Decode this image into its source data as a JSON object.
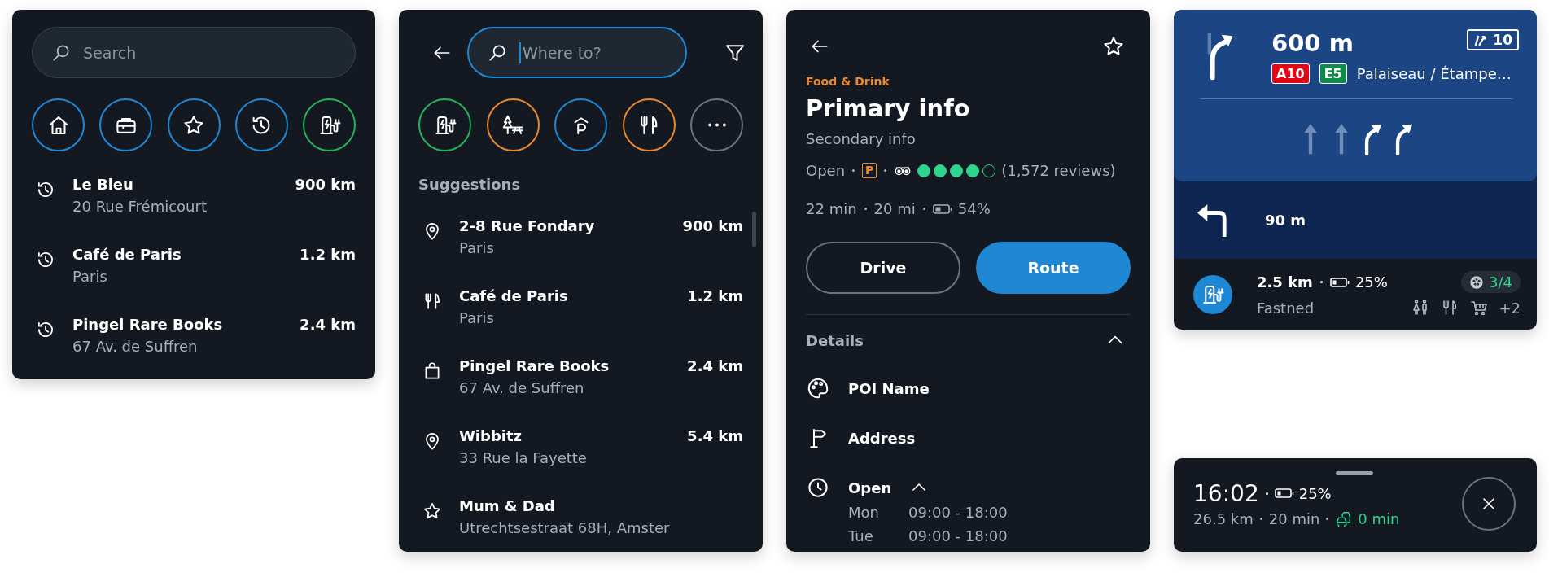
{
  "search_panel": {
    "search": {
      "placeholder": "Search"
    },
    "shortcuts": [
      {
        "kind": "home",
        "color": "#1e88d4"
      },
      {
        "kind": "work",
        "color": "#1e88d4"
      },
      {
        "kind": "favorite",
        "color": "#1e88d4"
      },
      {
        "kind": "recent",
        "color": "#1e88d4"
      },
      {
        "kind": "charging",
        "color": "#27b25a"
      }
    ],
    "recents": [
      {
        "kind": "recent",
        "name": "Le Bleu",
        "address": "20 Rue Frémicourt",
        "distance": "900 km"
      },
      {
        "kind": "recent",
        "name": "Café de Paris",
        "address": "Paris",
        "distance": "1.2 km"
      },
      {
        "kind": "recent",
        "name": "Pingel Rare Books",
        "address": "67 Av. de Suffren",
        "distance": "2.4 km"
      }
    ]
  },
  "suggest_panel": {
    "search": {
      "placeholder": "Where to?",
      "focused": true
    },
    "categories": [
      {
        "kind": "charging",
        "color": "#27b25a"
      },
      {
        "kind": "nature",
        "color": "#e8892f"
      },
      {
        "kind": "parking",
        "color": "#1e88d4"
      },
      {
        "kind": "food",
        "color": "#e8892f"
      },
      {
        "kind": "more",
        "color": "#6e737b"
      }
    ],
    "heading": "Suggestions",
    "items": [
      {
        "kind": "pin",
        "name": "2-8 Rue Fondary",
        "address": "Paris",
        "distance": "900 km"
      },
      {
        "kind": "food",
        "name": "Café de Paris",
        "address": "Paris",
        "distance": "1.2 km"
      },
      {
        "kind": "shop",
        "name": "Pingel Rare Books",
        "address": "67 Av. de Suffren",
        "distance": "2.4 km"
      },
      {
        "kind": "pin",
        "name": "Wibbitz",
        "address": "33 Rue la Fayette",
        "distance": "5.4 km"
      },
      {
        "kind": "favorite",
        "name": "Mum & Dad",
        "address": "Utrechtsestraat 68H, Amster"
      }
    ]
  },
  "poi_panel": {
    "favorite": false,
    "category": "Food & Drink",
    "title": "Primary info",
    "subtitle": "Secondary info",
    "status": "Open",
    "parking_badge": "P",
    "rating": {
      "stars": 4,
      "reviews": "(1,572 reviews)"
    },
    "eta": "22 min",
    "distance": "20 mi",
    "battery": "54%",
    "buttons": [
      {
        "label": "Drive",
        "kind": "secondary"
      },
      {
        "label": "Route",
        "kind": "primary"
      }
    ],
    "details": {
      "heading": "Details",
      "expanded": true,
      "items": [
        {
          "kind": "name",
          "label": "POI Name"
        },
        {
          "kind": "address",
          "label": "Address"
        },
        {
          "kind": "hours",
          "label": "Open",
          "expanded": true,
          "hours": [
            {
              "day": "Mon",
              "time": "09:00 - 18:00"
            },
            {
              "day": "Tue",
              "time": "09:00 - 18:00"
            }
          ]
        }
      ]
    }
  },
  "guidance": {
    "distance": "600 m",
    "exit": "10",
    "shields": [
      {
        "label": "A10",
        "color": "#e30613"
      },
      {
        "label": "E5",
        "color": "#10894a"
      }
    ],
    "direction": "Palaiseau / Étampe…",
    "lanes": [
      {
        "kind": "straight",
        "active": false
      },
      {
        "kind": "straight",
        "active": false
      },
      {
        "kind": "right",
        "active": true
      },
      {
        "kind": "right",
        "active": true
      }
    ],
    "next": {
      "distance": "90 m"
    },
    "charger": {
      "distance": "2.5 km",
      "battery": "25%",
      "availability": "3/4",
      "name": "Fastned",
      "amenities": [
        {
          "kind": "toilets"
        },
        {
          "kind": "food"
        },
        {
          "kind": "cart"
        }
      ],
      "more": "+2"
    }
  },
  "trip": {
    "arrival": "16:02",
    "battery": "25%",
    "distance": "26.5 km",
    "duration": "20 min",
    "delay": "0 min"
  }
}
